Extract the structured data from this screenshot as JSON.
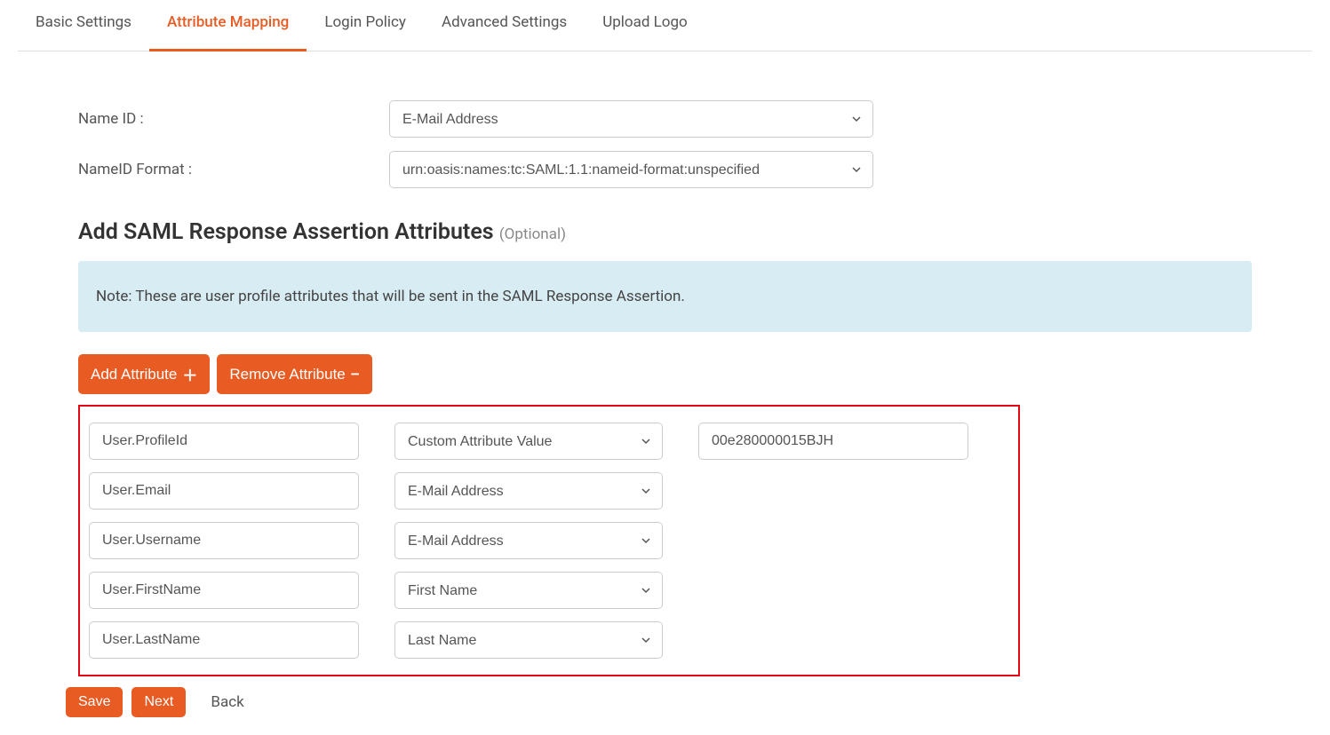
{
  "tabs": [
    {
      "label": "Basic Settings",
      "active": false
    },
    {
      "label": "Attribute Mapping",
      "active": true
    },
    {
      "label": "Login Policy",
      "active": false
    },
    {
      "label": "Advanced Settings",
      "active": false
    },
    {
      "label": "Upload Logo",
      "active": false
    }
  ],
  "form": {
    "nameid_label": "Name ID :",
    "nameid_value": "E-Mail Address",
    "nameid_format_label": "NameID Format :",
    "nameid_format_value": "urn:oasis:names:tc:SAML:1.1:nameid-format:unspecified"
  },
  "section": {
    "heading": "Add SAML Response Assertion Attributes",
    "optional": "(Optional)"
  },
  "note": "Note: These are user profile attributes that will be sent in the SAML Response Assertion.",
  "buttons": {
    "add_attribute": "Add Attribute",
    "remove_attribute": "Remove Attribute",
    "save": "Save",
    "next": "Next",
    "back": "Back"
  },
  "attributes": [
    {
      "name": "User.ProfileId",
      "type": "Custom Attribute Value",
      "value": "00e280000015BJH"
    },
    {
      "name": "User.Email",
      "type": "E-Mail Address",
      "value": ""
    },
    {
      "name": "User.Username",
      "type": "E-Mail Address",
      "value": ""
    },
    {
      "name": "User.FirstName",
      "type": "First Name",
      "value": ""
    },
    {
      "name": "User.LastName",
      "type": "Last Name",
      "value": ""
    }
  ]
}
